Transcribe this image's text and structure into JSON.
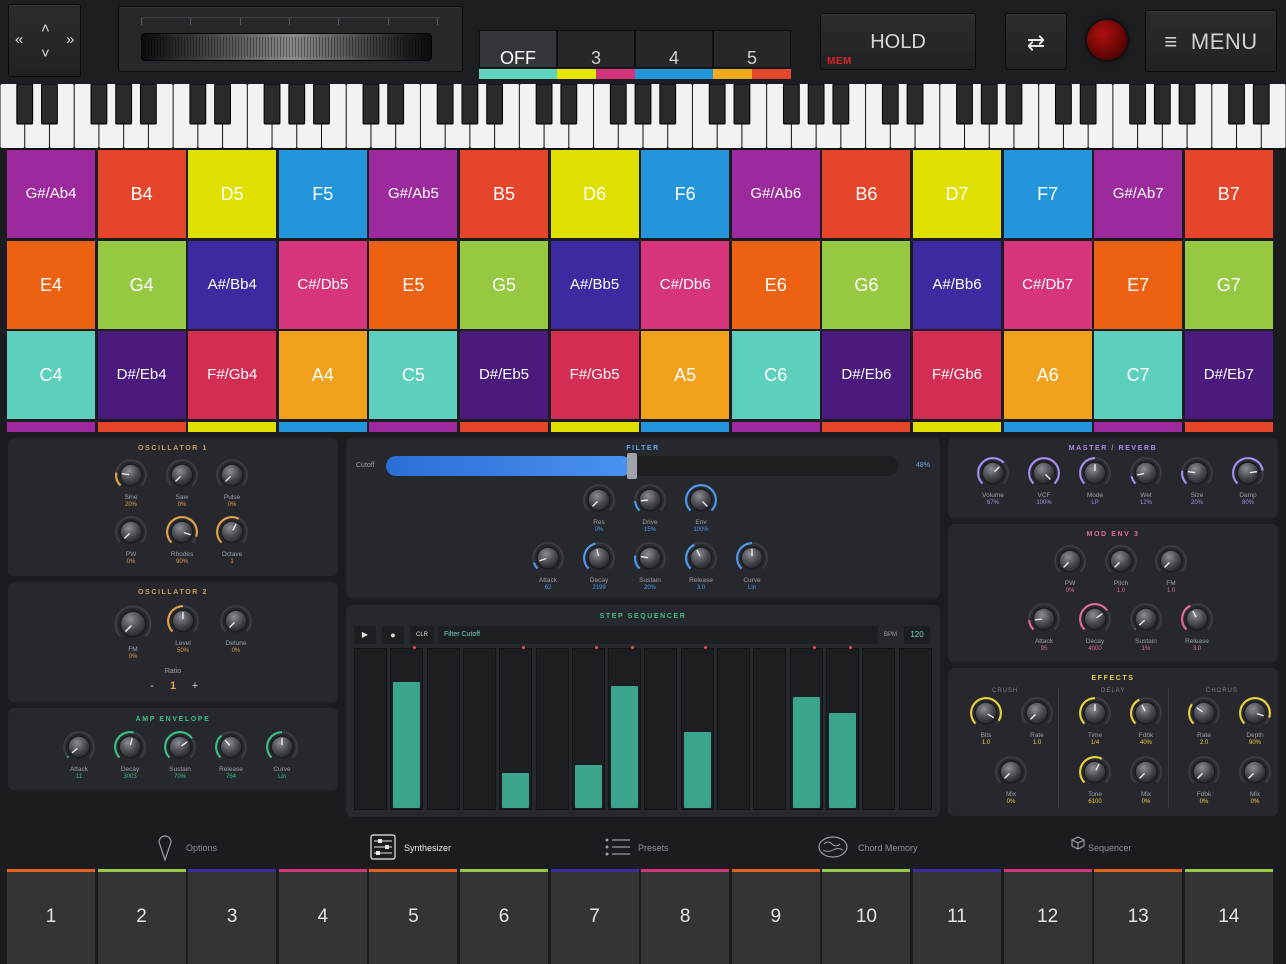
{
  "topbar": {
    "nav_prev": "«",
    "nav_next": "»",
    "nav_up": "˄",
    "nav_down": "˅",
    "mode_tabs": [
      {
        "label": "OFF",
        "color": "#5fd3bd"
      },
      {
        "label": "3",
        "color": "#e6e600"
      },
      {
        "label": "4",
        "color": "#2196d9"
      },
      {
        "label": "5",
        "color": "#f2a91c"
      }
    ],
    "mode_tab_colors_extra": [
      "#d6347a",
      "#e3452d"
    ],
    "hold_label": "HOLD",
    "mem_label": "MEM",
    "swap_icon": "⇄",
    "menu_icon": "≡",
    "menu_label": "MENU"
  },
  "pads": [
    [
      {
        "label": "G#/Ab4",
        "color": "#9c2a9c"
      },
      {
        "label": "B4",
        "color": "#e5452b"
      },
      {
        "label": "D5",
        "color": "#e0e000"
      },
      {
        "label": "F5",
        "color": "#2396db"
      },
      {
        "label": "G#/Ab5",
        "color": "#9c2a9c"
      },
      {
        "label": "B5",
        "color": "#e5452b"
      },
      {
        "label": "D6",
        "color": "#e0e000"
      },
      {
        "label": "F6",
        "color": "#2396db"
      },
      {
        "label": "G#/Ab6",
        "color": "#9c2a9c"
      },
      {
        "label": "B6",
        "color": "#e5452b"
      },
      {
        "label": "D7",
        "color": "#e0e000"
      },
      {
        "label": "F7",
        "color": "#2396db"
      },
      {
        "label": "G#/Ab7",
        "color": "#9c2a9c"
      },
      {
        "label": "B7",
        "color": "#e5452b"
      }
    ],
    [
      {
        "label": "E4",
        "color": "#ec6212"
      },
      {
        "label": "G4",
        "color": "#96c941"
      },
      {
        "label": "A#/Bb4",
        "color": "#3c2aa0"
      },
      {
        "label": "C#/Db5",
        "color": "#d6357c"
      },
      {
        "label": "E5",
        "color": "#ec6212"
      },
      {
        "label": "G5",
        "color": "#96c941"
      },
      {
        "label": "A#/Bb5",
        "color": "#3c2aa0"
      },
      {
        "label": "C#/Db6",
        "color": "#d6357c"
      },
      {
        "label": "E6",
        "color": "#ec6212"
      },
      {
        "label": "G6",
        "color": "#96c941"
      },
      {
        "label": "A#/Bb6",
        "color": "#3c2aa0"
      },
      {
        "label": "C#/Db7",
        "color": "#d6357c"
      },
      {
        "label": "E7",
        "color": "#ec6212"
      },
      {
        "label": "G7",
        "color": "#96c941"
      }
    ],
    [
      {
        "label": "C4",
        "color": "#5ccfbd"
      },
      {
        "label": "D#/Eb4",
        "color": "#4a1a7c"
      },
      {
        "label": "F#/Gb4",
        "color": "#d42d54"
      },
      {
        "label": "A4",
        "color": "#f2a11c"
      },
      {
        "label": "C5",
        "color": "#5ccfbd"
      },
      {
        "label": "D#/Eb5",
        "color": "#4a1a7c"
      },
      {
        "label": "F#/Gb5",
        "color": "#d42d54"
      },
      {
        "label": "A5",
        "color": "#f2a11c"
      },
      {
        "label": "C6",
        "color": "#5ccfbd"
      },
      {
        "label": "D#/Eb6",
        "color": "#4a1a7c"
      },
      {
        "label": "F#/Gb6",
        "color": "#d42d54"
      },
      {
        "label": "A6",
        "color": "#f2a11c"
      },
      {
        "label": "C7",
        "color": "#5ccfbd"
      },
      {
        "label": "D#/Eb7",
        "color": "#4a1a7c"
      }
    ]
  ],
  "osc1": {
    "title": "OSCILLATOR 1",
    "knobs": [
      {
        "label": "Sine",
        "value": "20%",
        "level": 0.2,
        "accent": "#e0a24a"
      },
      {
        "label": "Saw",
        "value": "0%",
        "level": 0,
        "accent": "#e0a24a"
      },
      {
        "label": "Pulse",
        "value": "0%",
        "level": 0,
        "accent": "#e0a24a"
      },
      {
        "label": "PW",
        "value": "0%",
        "level": 0,
        "accent": "#e0a24a"
      },
      {
        "label": "Rhodes",
        "value": "90%",
        "level": 0.9,
        "accent": "#e0a24a"
      },
      {
        "label": "Octave",
        "value": "1",
        "level": 0.6,
        "accent": "#e0a24a"
      }
    ]
  },
  "osc2": {
    "title": "OSCILLATOR 2",
    "knobs": [
      {
        "label": "FM",
        "value": "0%",
        "level": 0,
        "accent": "#e0a24a"
      },
      {
        "label": "Level",
        "value": "50%",
        "level": 0.5,
        "accent": "#e0a24a"
      },
      {
        "label": "Detune",
        "value": "0%",
        "level": 0,
        "accent": "#e0a24a"
      }
    ],
    "ratio_label": "Ratio",
    "ratio_minus": "-",
    "ratio_value": "1",
    "ratio_plus": "+"
  },
  "amp_env": {
    "title": "AMP ENVELOPE",
    "knobs": [
      {
        "label": "Attack",
        "value": "11",
        "level": 0.02,
        "accent": "#3cbf86"
      },
      {
        "label": "Decay",
        "value": "3003",
        "level": 0.55,
        "accent": "#3cbf86"
      },
      {
        "label": "Sustain",
        "value": "70%",
        "level": 0.7,
        "accent": "#3cbf86"
      },
      {
        "label": "Release",
        "value": "764",
        "level": 0.35,
        "accent": "#3cbf86"
      },
      {
        "label": "Curve",
        "value": "Lin",
        "level": 0.5,
        "accent": "#3cbf86"
      }
    ]
  },
  "filter": {
    "title": "FILTER",
    "cutoff_label": "Cutoff",
    "cutoff_value": "48%",
    "cutoff_level": 0.48,
    "knobs_row1": [
      {
        "label": "Res",
        "value": "0%",
        "level": 0,
        "accent": "#4f9af0"
      },
      {
        "label": "Drive",
        "value": "15%",
        "level": 0.15,
        "accent": "#4f9af0"
      },
      {
        "label": "Env",
        "value": "100%",
        "level": 1,
        "accent": "#4f9af0"
      }
    ],
    "knobs_row2": [
      {
        "label": "Attack",
        "value": "62",
        "level": 0.1,
        "accent": "#4f9af0"
      },
      {
        "label": "Decay",
        "value": "2199",
        "level": 0.45,
        "accent": "#4f9af0"
      },
      {
        "label": "Sustain",
        "value": "20%",
        "level": 0.2,
        "accent": "#4f9af0"
      },
      {
        "label": "Release",
        "value": "3.0",
        "level": 0.4,
        "accent": "#4f9af0"
      },
      {
        "label": "Curve",
        "value": "Lin",
        "level": 0.5,
        "accent": "#4f9af0"
      }
    ]
  },
  "sequencer": {
    "title": "STEP SEQUENCER",
    "play_icon": "▶",
    "record_icon": "●",
    "clear_label": "CLR",
    "target": "Filter Cutoff",
    "bpm_label": "BPM",
    "bpm_value": "120",
    "steps": [
      {
        "level": 0,
        "active": false
      },
      {
        "level": 0.8,
        "active": true
      },
      {
        "level": 0,
        "active": false
      },
      {
        "level": 0,
        "active": false
      },
      {
        "level": 0.22,
        "active": true
      },
      {
        "level": 0,
        "active": false
      },
      {
        "level": 0.27,
        "active": true
      },
      {
        "level": 0.77,
        "active": true
      },
      {
        "level": 0,
        "active": false
      },
      {
        "level": 0.48,
        "active": true
      },
      {
        "level": 0,
        "active": false
      },
      {
        "level": 0,
        "active": false
      },
      {
        "level": 0.7,
        "active": true
      },
      {
        "level": 0.6,
        "active": true
      },
      {
        "level": 0,
        "active": false
      },
      {
        "level": 0,
        "active": false
      }
    ]
  },
  "master": {
    "title": "MASTER / REVERB",
    "knobs": [
      {
        "label": "Volume",
        "value": "67%",
        "level": 0.67,
        "accent": "#a68cf0"
      },
      {
        "label": "VCF",
        "value": "100%",
        "level": 1,
        "accent": "#a68cf0"
      },
      {
        "label": "Mode",
        "value": "LP",
        "level": 0.5,
        "accent": "#a68cf0"
      },
      {
        "label": "Wet",
        "value": "12%",
        "level": 0.12,
        "accent": "#a68cf0"
      },
      {
        "label": "Size",
        "value": "20%",
        "level": 0.2,
        "accent": "#a68cf0"
      },
      {
        "label": "Damp",
        "value": "80%",
        "level": 0.8,
        "accent": "#a68cf0"
      }
    ]
  },
  "mod_env": {
    "title": "MOD ENV 3",
    "knobs_row1": [
      {
        "label": "PW",
        "value": "0%",
        "level": 0,
        "accent": "#e06b9a"
      },
      {
        "label": "Pitch",
        "value": "1.0",
        "level": 0,
        "accent": "#e06b9a"
      },
      {
        "label": "FM",
        "value": "1.0",
        "level": 0,
        "accent": "#e06b9a"
      }
    ],
    "knobs_row2": [
      {
        "label": "Attack",
        "value": "95",
        "level": 0.15,
        "accent": "#e06b9a"
      },
      {
        "label": "Decay",
        "value": "4000",
        "level": 0.7,
        "accent": "#e06b9a"
      },
      {
        "label": "Sustain",
        "value": "1%",
        "level": 0.01,
        "accent": "#e06b9a"
      },
      {
        "label": "Release",
        "value": "3.0",
        "level": 0.4,
        "accent": "#e06b9a"
      }
    ]
  },
  "effects": {
    "title": "EFFECTS",
    "crush_label": "CRUSH",
    "delay_label": "DELAY",
    "chorus_label": "CHORUS",
    "crush_knobs": [
      {
        "label": "Bits",
        "value": "1.0",
        "level": 0.95,
        "accent": "#e8d23a"
      },
      {
        "label": "Rate",
        "value": "1.0",
        "level": 0,
        "accent": "#e8d23a"
      },
      {
        "label": "Mix",
        "value": "0%",
        "level": 0,
        "accent": "#e8d23a"
      }
    ],
    "delay_knobs": [
      {
        "label": "Time",
        "value": "1/4",
        "level": 0.5,
        "accent": "#e8d23a"
      },
      {
        "label": "Fdbk",
        "value": "40%",
        "level": 0.4,
        "accent": "#e8d23a"
      },
      {
        "label": "Tone",
        "value": "6100",
        "level": 0.6,
        "accent": "#e8d23a"
      },
      {
        "label": "Mix",
        "value": "0%",
        "level": 0,
        "accent": "#e8d23a"
      }
    ],
    "chorus_knobs": [
      {
        "label": "Rate",
        "value": "2.0",
        "level": 0.3,
        "accent": "#e8d23a"
      },
      {
        "label": "Depth",
        "value": "90%",
        "level": 0.9,
        "accent": "#e8d23a"
      },
      {
        "label": "Fdbk",
        "value": "0%",
        "level": 0,
        "accent": "#e8d23a"
      },
      {
        "label": "Mix",
        "value": "0%",
        "level": 0,
        "accent": "#e8d23a"
      }
    ]
  },
  "tabbar": [
    {
      "label": "Options",
      "icon": "ice-cream-icon",
      "selected": false
    },
    {
      "label": "Synthesizer",
      "icon": "sliders-icon",
      "selected": true
    },
    {
      "label": "Presets",
      "icon": "list-icon",
      "selected": false
    },
    {
      "label": "Chord Memory",
      "icon": "brain-icon",
      "selected": false
    },
    {
      "label": "Sequencer",
      "icon": "cube-icon",
      "selected": false
    }
  ],
  "chord_buttons": [
    {
      "label": "1",
      "color": "#ec6212"
    },
    {
      "label": "2",
      "color": "#96c941"
    },
    {
      "label": "3",
      "color": "#3c2aa0"
    },
    {
      "label": "4",
      "color": "#d6357c"
    },
    {
      "label": "5",
      "color": "#ec6212"
    },
    {
      "label": "6",
      "color": "#96c941"
    },
    {
      "label": "7",
      "color": "#3c2aa0"
    },
    {
      "label": "8",
      "color": "#d6357c"
    },
    {
      "label": "9",
      "color": "#ec6212"
    },
    {
      "label": "10",
      "color": "#96c941"
    },
    {
      "label": "11",
      "color": "#3c2aa0"
    },
    {
      "label": "12",
      "color": "#d6357c"
    },
    {
      "label": "13",
      "color": "#ec6212"
    },
    {
      "label": "14",
      "color": "#96c941"
    }
  ]
}
